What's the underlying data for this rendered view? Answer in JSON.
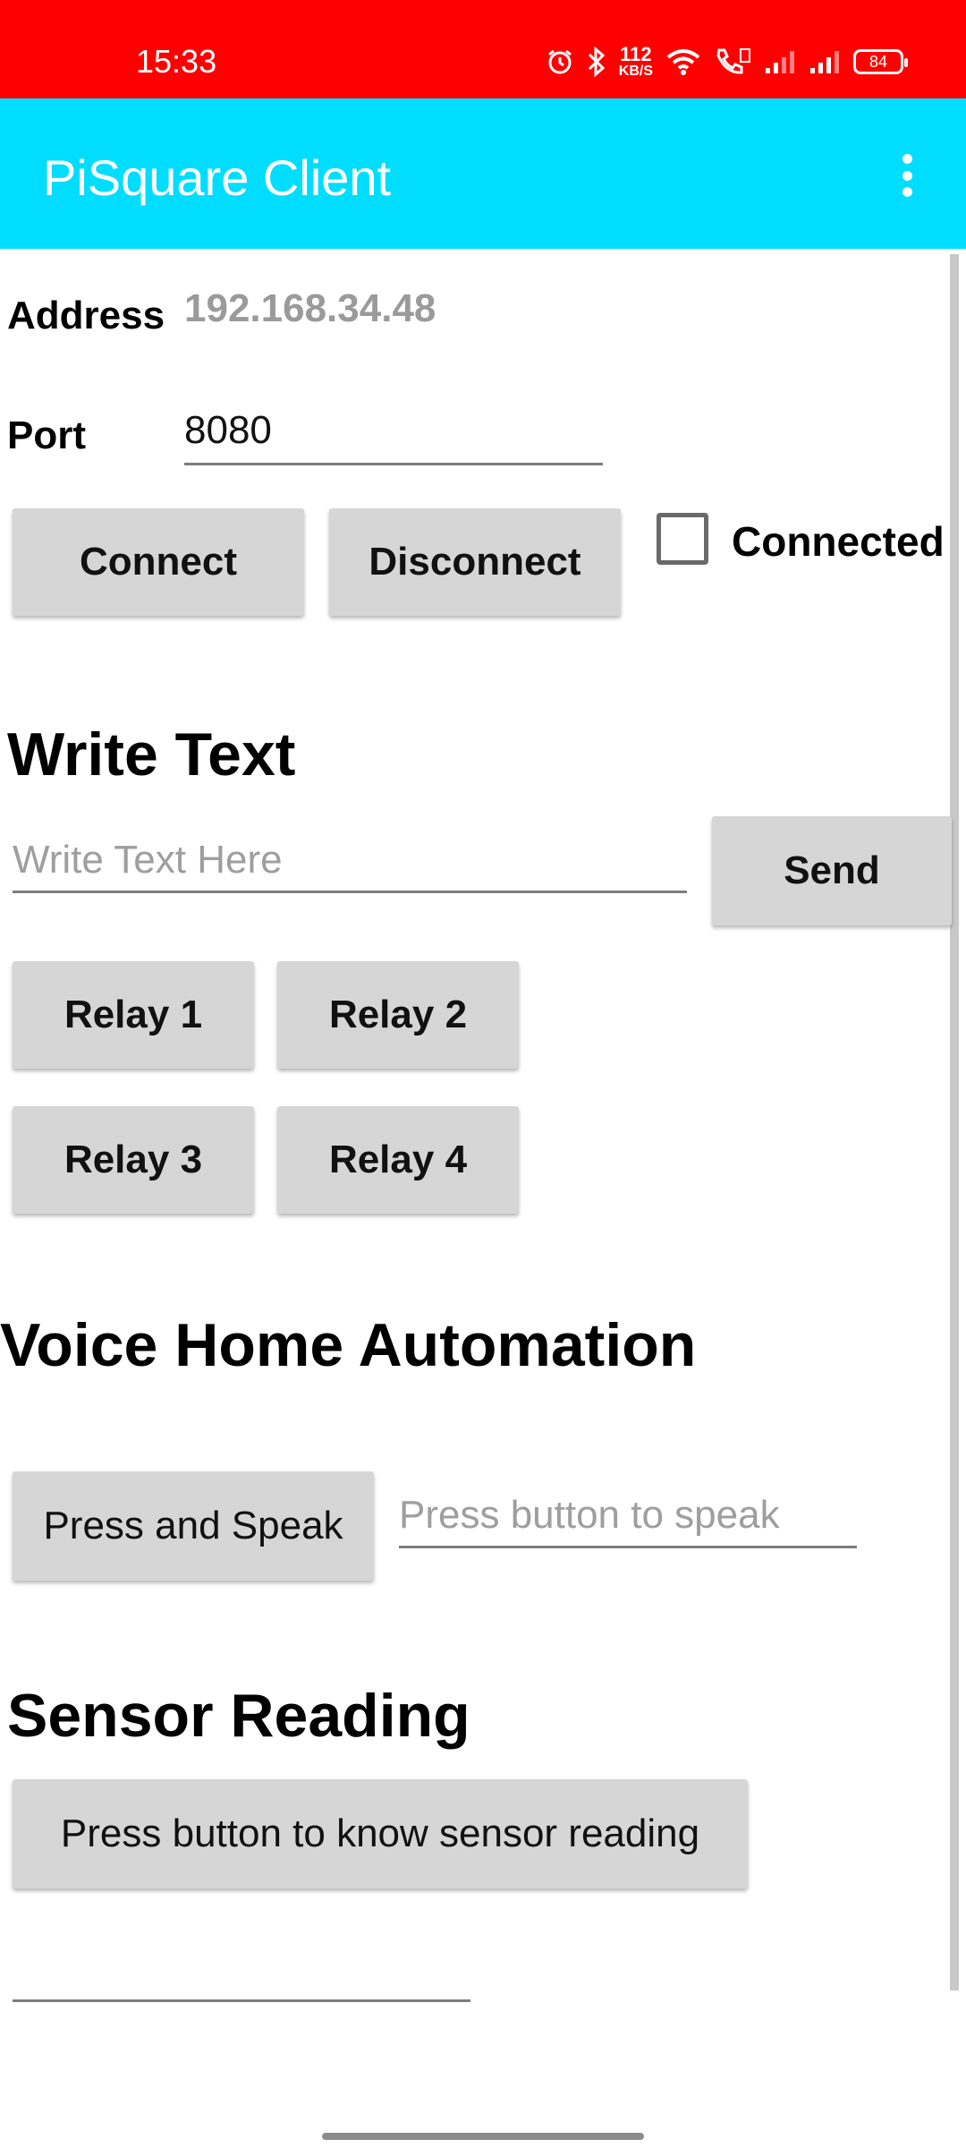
{
  "status_bar": {
    "time": "15:33",
    "network_speed": "112",
    "network_speed_unit": "KB/S",
    "battery": "84",
    "icons": [
      "alarm-icon",
      "bluetooth-icon",
      "wifi-icon",
      "wifi-calling-icon",
      "signal-icon",
      "signal-icon",
      "battery-icon"
    ]
  },
  "app_bar": {
    "title": "PiSquare Client",
    "menu_icon": "overflow-menu-icon"
  },
  "connection": {
    "address_label": "Address",
    "address_value": "192.168.34.48",
    "port_label": "Port",
    "port_value": "8080",
    "connect_label": "Connect",
    "disconnect_label": "Disconnect",
    "connected_label": "Connected",
    "connected_checked": false
  },
  "write_text": {
    "heading": "Write Text",
    "input_placeholder": "Write Text Here",
    "send_label": "Send"
  },
  "relays": {
    "relay1": "Relay 1",
    "relay2": "Relay 2",
    "relay3": "Relay 3",
    "relay4": "Relay 4"
  },
  "voice": {
    "heading": "Voice Home Automation",
    "button_label": "Press and Speak",
    "input_placeholder": "Press button to speak"
  },
  "sensor": {
    "heading": "Sensor Reading",
    "button_label": "Press button to know sensor reading",
    "output_value": ""
  },
  "colors": {
    "status_bar": "#ff0000",
    "app_bar": "#00ddff",
    "button": "#d6d6d6"
  }
}
